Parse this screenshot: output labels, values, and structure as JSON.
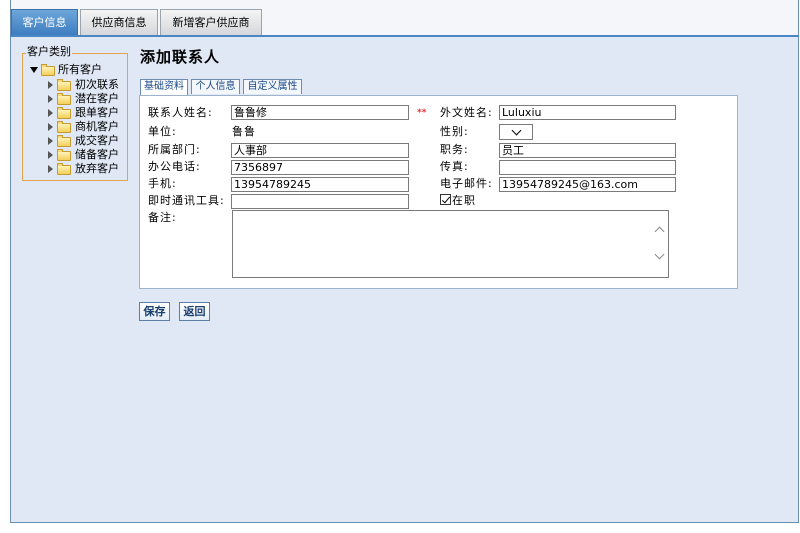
{
  "top_tabs": [
    {
      "label": "客户信息",
      "active": true
    },
    {
      "label": "供应商信息",
      "active": false
    },
    {
      "label": "新增客户供应商",
      "active": false
    }
  ],
  "tree": {
    "legend": "客户类别",
    "root": "所有客户",
    "items": [
      "初次联系",
      "潜在客户",
      "跟单客户",
      "商机客户",
      "成交客户",
      "储备客户",
      "放弃客户"
    ]
  },
  "page_title": "添加联系人",
  "sub_tabs": [
    {
      "label": "基础资料",
      "active": true
    },
    {
      "label": "个人信息",
      "active": false
    },
    {
      "label": "自定义属性",
      "active": false
    }
  ],
  "form": {
    "contact_name_label": "联系人姓名:",
    "contact_name_value": "鲁鲁修",
    "required_mark": "**",
    "foreign_name_label": "外文姓名:",
    "foreign_name_value": "Luluxiu",
    "company_label": "单位:",
    "company_value": "鲁鲁",
    "gender_label": "性别:",
    "gender_value": "",
    "department_label": "所属部门:",
    "department_value": "人事部",
    "position_label": "职务:",
    "position_value": "员工",
    "office_phone_label": "办公电话:",
    "office_phone_value": "7356897",
    "fax_label": "传真:",
    "fax_value": "",
    "mobile_label": "手机:",
    "mobile_value": "13954789245",
    "email_label": "电子邮件:",
    "email_value": "13954789245@163.com",
    "im_label": "即时通讯工具:",
    "im_value": "",
    "employed_label": "在职",
    "employed_checked": true,
    "remarks_label": "备注:",
    "remarks_value": ""
  },
  "buttons": {
    "save": "保存",
    "back": "返回"
  },
  "colors": {
    "active_tab": "#4a86c5",
    "background": "#dfe8f4",
    "required": "#dd3333"
  }
}
